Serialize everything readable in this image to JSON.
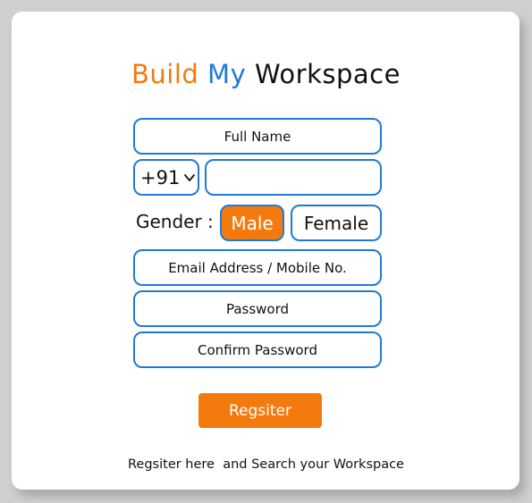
{
  "title": {
    "word1": "Build",
    "word2": "My",
    "word3": "Workspace"
  },
  "form": {
    "full_name_placeholder": "Full Name",
    "country_code": "+91",
    "phone_value": "",
    "gender_label": "Gender :",
    "gender_options": [
      "Male",
      "Female"
    ],
    "gender_selected": "Male",
    "email_placeholder": "Email Address / Mobile No.",
    "password_placeholder": "Password",
    "confirm_password_placeholder": "Confirm Password",
    "submit_label": "Regsiter"
  },
  "footer_text": "Regsiter here  and Search your Workspace",
  "colors": {
    "accent_orange": "#f57a0e",
    "accent_blue": "#1f7ad6",
    "text": "#111111",
    "background": "#cfcfcf",
    "card": "#ffffff"
  },
  "icons": {
    "country_code_dropdown": "chevron-down-icon"
  }
}
